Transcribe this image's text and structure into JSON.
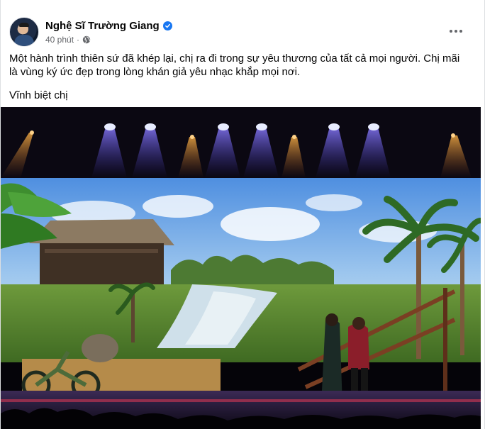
{
  "post": {
    "author_name": "Nghệ Sĩ Trường Giang",
    "timestamp": "40 phút",
    "separator": "·",
    "caption_line1": "Một hành trình thiên sứ đã khép lại, chị ra đi trong sự yêu thương của tất cả mọi người. Chị mãi là vùng ký ức đẹp trong lòng khán giả yêu nhạc khắp mọi nơi.",
    "caption_line2": "Vĩnh biệt chị"
  },
  "icons": {
    "verified": "verified-badge-icon",
    "audience": "globe-icon",
    "menu": "more-horizontal-icon"
  },
  "colors": {
    "name_text": "#050505",
    "meta_text": "#65676b",
    "verified_blue": "#1877f2"
  }
}
